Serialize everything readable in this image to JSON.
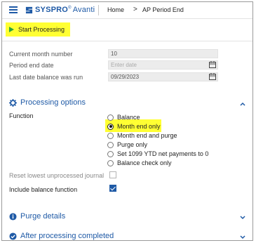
{
  "nav": {
    "brand": "SYSPRO",
    "brand_reg": "®",
    "brand_sub": "Avanti",
    "home": "Home",
    "current": "AP Period End"
  },
  "toolbar": {
    "start_label": "Start Processing"
  },
  "form": {
    "current_month_label": "Current month number",
    "current_month_value": "10",
    "period_end_label": "Period end date",
    "period_end_placeholder": "Enter date",
    "last_run_label": "Last date balance was run",
    "last_run_value": "09/29/2023"
  },
  "processing": {
    "title": "Processing options",
    "function_label": "Function",
    "options": [
      {
        "label": "Balance",
        "selected": false
      },
      {
        "label": "Month end only",
        "selected": true
      },
      {
        "label": "Month end and purge",
        "selected": false
      },
      {
        "label": "Purge only",
        "selected": false
      },
      {
        "label": "Set 1099 YTD net payments to 0",
        "selected": false
      },
      {
        "label": "Balance check only",
        "selected": false
      }
    ],
    "reset_label": "Reset lowest unprocessed journal",
    "reset_checked": false,
    "include_balance_label": "Include balance function",
    "include_balance_checked": true
  },
  "sections": {
    "purge_title": "Purge details",
    "after_title": "After processing completed"
  },
  "colors": {
    "brand_blue": "#1f5aa6",
    "highlight": "#ffff33",
    "play_green": "#2ca53e"
  }
}
